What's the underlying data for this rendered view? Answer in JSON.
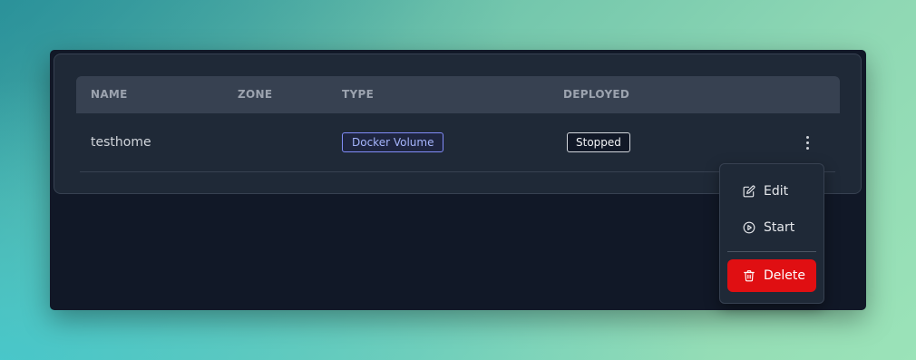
{
  "table": {
    "columns": {
      "name": "NAME",
      "zone": "ZONE",
      "type": "TYPE",
      "deployed": "DEPLOYED"
    },
    "rows": [
      {
        "name": "testhome",
        "zone": "",
        "type": "Docker Volume",
        "deployed": "Stopped"
      }
    ]
  },
  "menu": {
    "items": [
      {
        "label": "Edit",
        "icon": "edit-icon"
      },
      {
        "label": "Start",
        "icon": "play-circle-icon"
      },
      {
        "label": "Delete",
        "icon": "trash-icon"
      }
    ]
  },
  "colors": {
    "window_bg": "#111827",
    "card_bg": "#1f2937",
    "header_bg": "#374151",
    "type_badge": "#818cf8",
    "delete_bg": "#e00f12"
  }
}
